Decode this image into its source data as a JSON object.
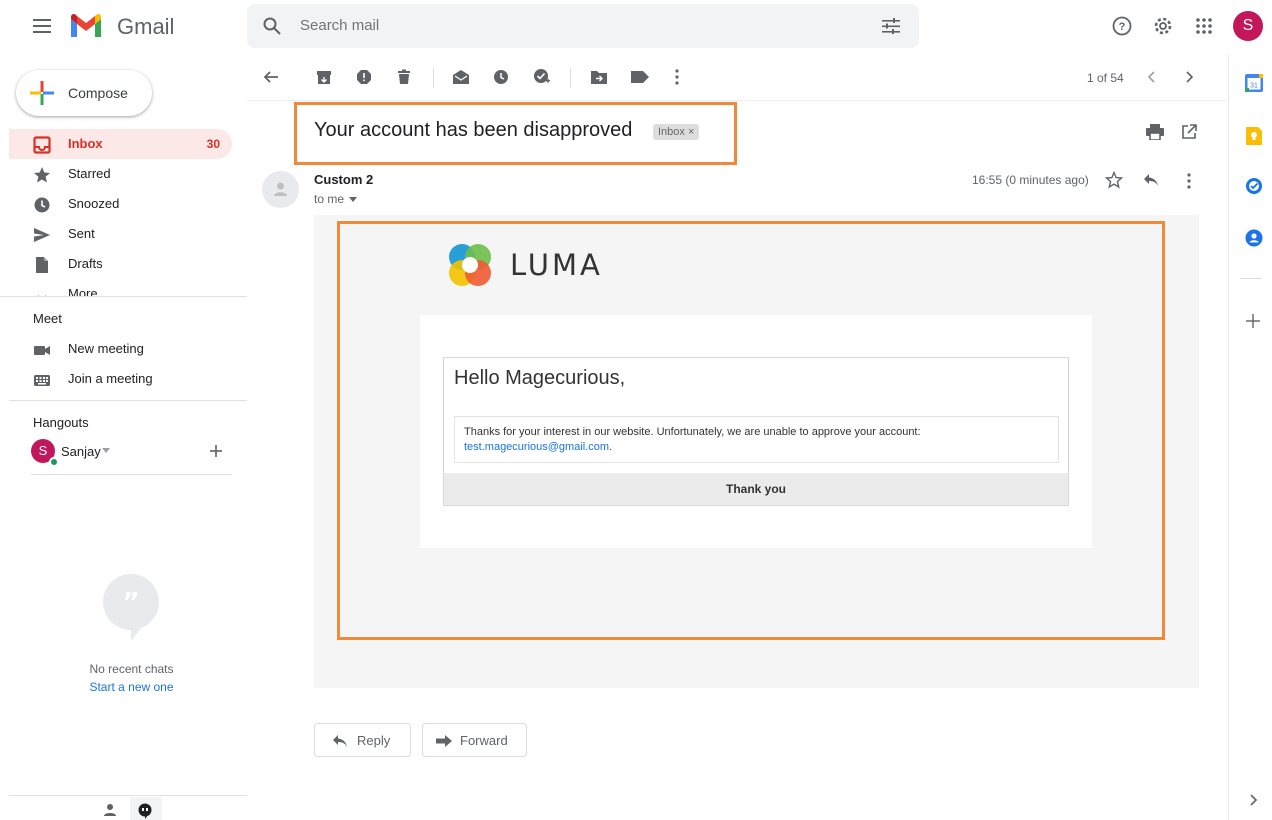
{
  "header": {
    "app_name": "Gmail",
    "search_placeholder": "Search mail",
    "avatar_letter": "S"
  },
  "sidebar": {
    "compose_label": "Compose",
    "items": [
      {
        "label": "Inbox",
        "count": "30"
      },
      {
        "label": "Starred"
      },
      {
        "label": "Snoozed"
      },
      {
        "label": "Sent"
      },
      {
        "label": "Drafts"
      },
      {
        "label": "More"
      }
    ],
    "meet": {
      "title": "Meet",
      "items": [
        {
          "label": "New meeting"
        },
        {
          "label": "Join a meeting"
        }
      ]
    },
    "hangouts": {
      "title": "Hangouts",
      "user_name": "Sanjay",
      "user_initial": "S",
      "no_chats": "No recent chats",
      "start_new": "Start a new one"
    }
  },
  "toolbar": {
    "page_info": "1 of 54"
  },
  "message": {
    "subject": "Your account has been disapproved",
    "label_chip": "Inbox",
    "sender": "Custom 2",
    "recipient": "to me",
    "time": "16:55 (0 minutes ago)",
    "logo_text": "LUMA",
    "greeting": "Hello Magecurious,",
    "body_text": "Thanks for your interest in our website. Unfortunately, we are unable to approve your account:",
    "body_email": "test.magecurious@gmail.com",
    "body_suffix": ".",
    "footer": "Thank you"
  },
  "actions": {
    "reply": "Reply",
    "forward": "Forward"
  },
  "colors": {
    "highlight": "#f08a3a",
    "inbox_active_bg": "#fce8e6",
    "inbox_active_text": "#d93025",
    "avatar_bg": "#c2185b",
    "link": "#1a73e8"
  }
}
